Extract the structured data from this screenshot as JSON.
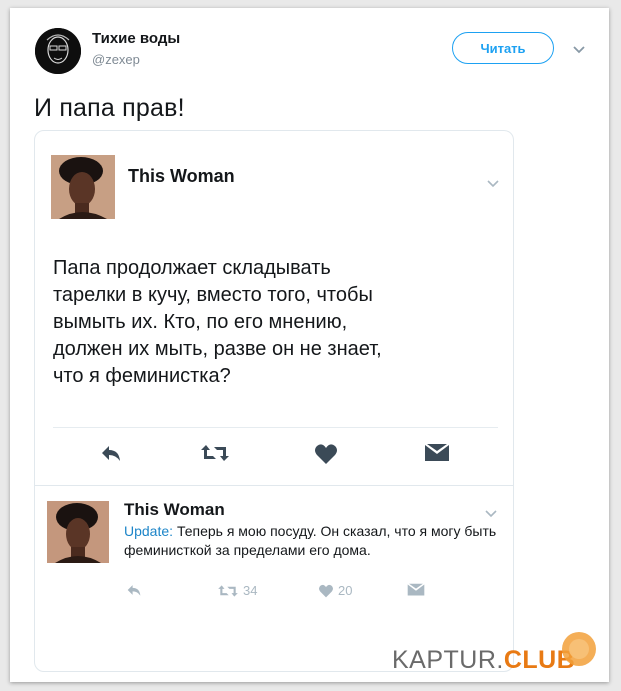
{
  "tweet": {
    "author_name": "Тихие воды",
    "author_handle": "@zexep",
    "follow_label": "Читать",
    "text": "И папа прав!"
  },
  "quoted": {
    "author_name": "This Woman",
    "text": "Папа продолжает складывать\nтарелки в кучу, вместо того, чтобы\nвымыть их. Кто, по его мнению,\nдолжен их мыть, разве он не знает,\nчто я феминистка?"
  },
  "reply": {
    "author_name": "This Woman",
    "prefix": "Update:",
    "text": "Теперь я мою посуду. Он сказал, что я могу быть феминисткой за пределами его дома.",
    "retweets": "34",
    "likes": "20"
  },
  "watermark": {
    "main": "KAPTUR.",
    "accent": "CLUB"
  },
  "colors": {
    "accent": "#1da1f2",
    "icon": "#3b4a57",
    "watermark_accent": "#e87a14"
  }
}
